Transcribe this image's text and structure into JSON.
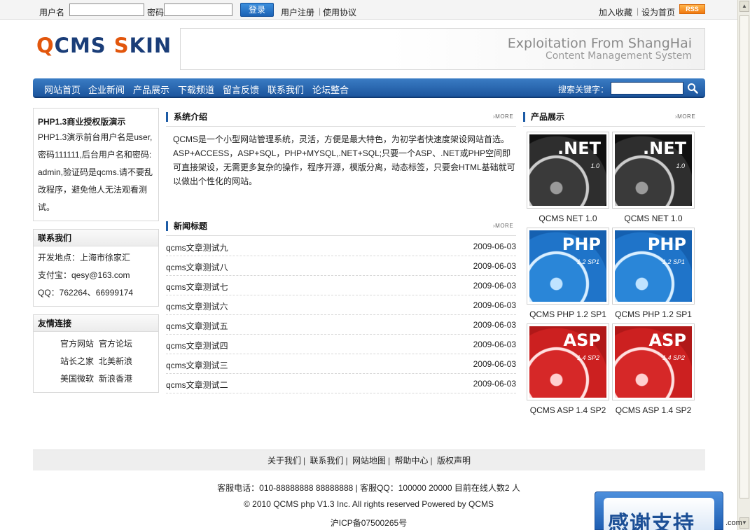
{
  "topbar": {
    "username_label": "用户名",
    "password_label": "密码",
    "login_button": "登录",
    "register_link": "用户注册",
    "terms_link": "使用协议",
    "bookmark_link": "加入收藏",
    "homepage_link": "设为首页",
    "rss_badge": "RSS"
  },
  "header": {
    "logo_q": "Q",
    "logo_cms": "CMS ",
    "logo_s": "S",
    "logo_kin": "KIN",
    "banner_line1": "Exploitation From ShangHai",
    "banner_line2": "Content Management System"
  },
  "nav": {
    "items": [
      "网站首页",
      "企业新闻",
      "产品展示",
      "下载频道",
      "留言反馈",
      "联系我们",
      "论坛整合"
    ],
    "search_label": "搜索关键字："
  },
  "sidebar": {
    "intro_title": "PHP1.3商业授权版演示",
    "intro_body": "PHP1.3演示前台用户名是user,密码111111,后台用户名和密码:admin,验证码是qcms.请不要乱改程序，避免他人无法观看测试。",
    "contact": {
      "title": "联系我们",
      "lines": [
        "开发地点：上海市徐家汇",
        "支付宝：qesy@163.com",
        "QQ：762264、66999174"
      ]
    },
    "friends": {
      "title": "友情连接",
      "rows": [
        [
          "官方网站",
          "官方论坛"
        ],
        [
          "站长之家",
          "北美新浪"
        ],
        [
          "美国微软",
          "新浪香港"
        ]
      ]
    }
  },
  "system_intro": {
    "title": "系统介绍",
    "more": "MORE",
    "text": "QCMS是一个小型网站管理系统，灵活，方便是最大特色，为初学者快速度架设网站首选。ASP+ACCESS，ASP+SQL，PHP+MYSQL,.NET+SQL;只要一个ASP、.NET或PHP空间即可直接架设，无需更多复杂的操作，程序开源，模版分离，动态标签，只要会HTML基础就可以做出个性化的网站。"
  },
  "news": {
    "title": "新闻标题",
    "more": "MORE",
    "items": [
      {
        "title": "qcms文章测试九",
        "date": "2009-06-03"
      },
      {
        "title": "qcms文章测试八",
        "date": "2009-06-03"
      },
      {
        "title": "qcms文章测试七",
        "date": "2009-06-03"
      },
      {
        "title": "qcms文章测试六",
        "date": "2009-06-03"
      },
      {
        "title": "qcms文章测试五",
        "date": "2009-06-03"
      },
      {
        "title": "qcms文章测试四",
        "date": "2009-06-03"
      },
      {
        "title": "qcms文章测试三",
        "date": "2009-06-03"
      },
      {
        "title": "qcms文章测试二",
        "date": "2009-06-03"
      }
    ]
  },
  "products": {
    "title": "产品展示",
    "more": "MORE",
    "items": [
      {
        "name": "QCMS NET 1.0",
        "label": ".NET",
        "ver": "1.0",
        "kind": "net"
      },
      {
        "name": "QCMS NET 1.0",
        "label": ".NET",
        "ver": "1.0",
        "kind": "net"
      },
      {
        "name": "QCMS PHP 1.2 SP1",
        "label": "PHP",
        "ver": "1.2 SP1",
        "kind": "php"
      },
      {
        "name": "QCMS PHP 1.2 SP1",
        "label": "PHP",
        "ver": "1.2 SP1",
        "kind": "php"
      },
      {
        "name": "QCMS ASP 1.4 SP2",
        "label": "ASP",
        "ver": "1.4 SP2",
        "kind": "asp"
      },
      {
        "name": "QCMS ASP 1.4 SP2",
        "label": "ASP",
        "ver": "1.4 SP2",
        "kind": "asp"
      }
    ]
  },
  "footer": {
    "links": [
      "关于我们",
      "联系我们",
      "网站地图",
      "帮助中心",
      "版权声明"
    ],
    "service": "客服电话：010-88888888 88888888 | 客服QQ：100000 20000 目前在线人数2 人",
    "copyright": "© 2010 QCMS php V1.3 Inc. All rights reserved Powered by QCMS",
    "icp": "沪ICP备07500265号"
  },
  "float_ad": {
    "text": "感谢支持",
    "suffix": ".com"
  }
}
